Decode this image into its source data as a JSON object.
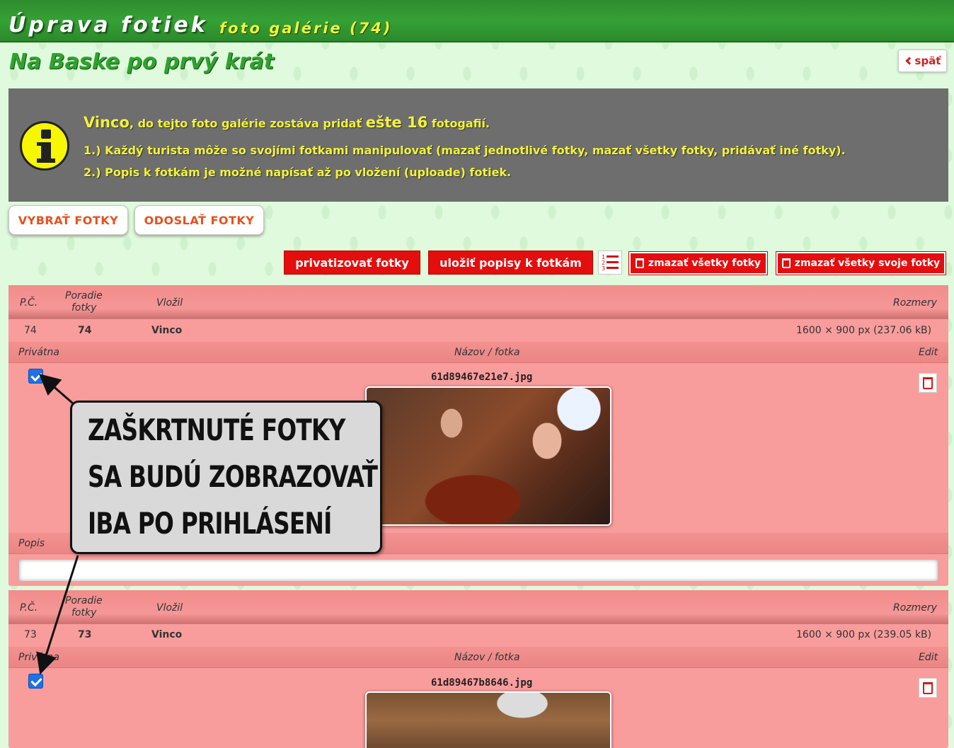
{
  "header": {
    "title": "Úprava fotiek",
    "subtitle": "foto galérie (74)"
  },
  "gallery_name": "Na Baske po prvý krát",
  "back_button": {
    "label": "späť"
  },
  "info": {
    "user": "Vinco",
    "line1_mid": ", do tejto foto galérie zostáva pridať ",
    "line1_big": "ešte 16",
    "line1_end": " fotogafií.",
    "line2": "1.) Každý turista môže so svojími fotkami manipulovať (mazať jednotlivé fotky, mazať všetky fotky, pridávať iné fotky).",
    "line3": "2.) Popis k fotkám je možné napísať až po vložení (uploade) fotiek."
  },
  "upload_buttons": {
    "select": "VYBRAŤ FOTKY",
    "send": "ODOSLAŤ FOTKY"
  },
  "actions": {
    "privatize": "privatizovať fotky",
    "save_desc": "uložiť popisy k fotkám",
    "delete_all": "zmazať všetky fotky",
    "delete_all_own": "zmazať všetky svoje fotky"
  },
  "columns": {
    "pc": "P.Č.",
    "order_line1": "Poradie",
    "order_line2": "fotky",
    "uploader": "Vložil",
    "dimensions": "Rozmery",
    "private": "Privátna",
    "name_photo": "Názov / fotka",
    "edit": "Edit",
    "description": "Popis"
  },
  "photos": [
    {
      "pc": "74",
      "order": "74",
      "uploader": "Vinco",
      "dimensions": "1600 × 900 px (237.06 kB)",
      "filename": "61d89467e21e7.jpg",
      "private": true,
      "description": ""
    },
    {
      "pc": "73",
      "order": "73",
      "uploader": "Vinco",
      "dimensions": "1600 × 900 px (239.05 kB)",
      "filename": "61d89467b8646.jpg",
      "private": true
    }
  ],
  "callout": {
    "line1": "ZAŠKRTNUTÉ FOTKY",
    "line2": "SA BUDÚ ZOBRAZOVAŤ",
    "line3": "IBA PO PRIHLÁSENÍ"
  }
}
